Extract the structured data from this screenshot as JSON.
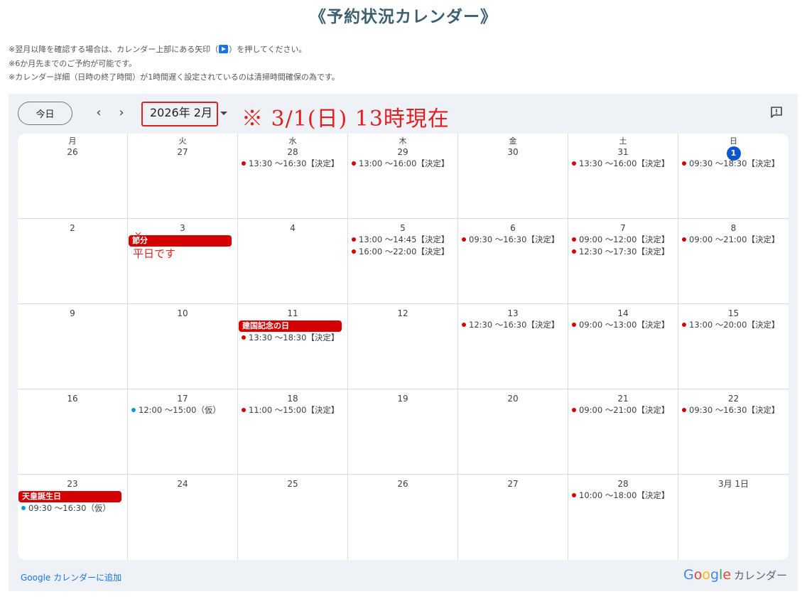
{
  "page_title": "《予約状況カレンダー》",
  "notes": {
    "line1_a": "※翌月以降を確認する場合は、カレンダー上部にある矢印（",
    "line1_b": "）を押してください。",
    "line2": "※6か月先までのご予約が可能です。",
    "line3": "※カレンダー詳細（日時の終了時間）が1時間遅く設定されているのは清掃時間確保の為です。"
  },
  "toolbar": {
    "today_label": "今日",
    "prev_glyph": "‹",
    "next_glyph": "›",
    "month_label": "2026年 2月",
    "handwritten_note": "※ 3/1(日) 13時現在"
  },
  "colors": {
    "confirmed_dot": "#d50000",
    "tentative_dot": "#039be5",
    "holiday_bg": "#d50000",
    "today_circle": "#0b57d0"
  },
  "weekdays": [
    "月",
    "火",
    "水",
    "木",
    "金",
    "土",
    "日"
  ],
  "weeks": [
    [
      {
        "day": "26",
        "events": []
      },
      {
        "day": "27",
        "events": []
      },
      {
        "day": "28",
        "events": [
          {
            "text": "13:30 〜16:30【決定】",
            "status": "confirmed"
          }
        ]
      },
      {
        "day": "29",
        "events": [
          {
            "text": "13:00 〜16:00【決定】",
            "status": "confirmed"
          }
        ]
      },
      {
        "day": "30",
        "events": []
      },
      {
        "day": "31",
        "events": [
          {
            "text": "13:30 〜16:00【決定】",
            "status": "confirmed"
          }
        ]
      },
      {
        "day": "1",
        "today": true,
        "events": [
          {
            "text": "09:30 〜18:30【決定】",
            "status": "confirmed"
          }
        ]
      }
    ],
    [
      {
        "day": "2",
        "events": []
      },
      {
        "day": "3",
        "holiday": "節分",
        "handnote": "平日です",
        "events": []
      },
      {
        "day": "4",
        "events": []
      },
      {
        "day": "5",
        "events": [
          {
            "text": "13:00 〜14:45【決定】",
            "status": "confirmed"
          },
          {
            "text": "16:00 〜22:00【決定】",
            "status": "confirmed"
          }
        ]
      },
      {
        "day": "6",
        "events": [
          {
            "text": "09:30 〜16:30【決定】",
            "status": "confirmed"
          }
        ]
      },
      {
        "day": "7",
        "events": [
          {
            "text": "09:00 〜12:00【決定】",
            "status": "confirmed"
          },
          {
            "text": "12:30 〜17:30【決定】",
            "status": "confirmed"
          }
        ]
      },
      {
        "day": "8",
        "events": [
          {
            "text": "09:00 〜21:00【決定】",
            "status": "confirmed"
          }
        ]
      }
    ],
    [
      {
        "day": "9",
        "events": []
      },
      {
        "day": "10",
        "events": []
      },
      {
        "day": "11",
        "holiday": "建国記念の日",
        "events": [
          {
            "text": "13:30 〜18:30【決定】",
            "status": "confirmed"
          }
        ]
      },
      {
        "day": "12",
        "events": []
      },
      {
        "day": "13",
        "events": [
          {
            "text": "12:30 〜16:30【決定】",
            "status": "confirmed"
          }
        ]
      },
      {
        "day": "14",
        "events": [
          {
            "text": "09:00 〜13:00【決定】",
            "status": "confirmed"
          }
        ]
      },
      {
        "day": "15",
        "events": [
          {
            "text": "13:00 〜20:00【決定】",
            "status": "confirmed"
          }
        ]
      }
    ],
    [
      {
        "day": "16",
        "events": []
      },
      {
        "day": "17",
        "events": [
          {
            "text": "12:00 〜15:00（仮）",
            "status": "tentative"
          }
        ]
      },
      {
        "day": "18",
        "events": [
          {
            "text": "11:00 〜15:00【決定】",
            "status": "confirmed"
          }
        ]
      },
      {
        "day": "19",
        "events": []
      },
      {
        "day": "20",
        "events": []
      },
      {
        "day": "21",
        "events": [
          {
            "text": "09:00 〜21:00【決定】",
            "status": "confirmed"
          }
        ]
      },
      {
        "day": "22",
        "events": [
          {
            "text": "09:30 〜16:30【決定】",
            "status": "confirmed"
          }
        ]
      }
    ],
    [
      {
        "day": "23",
        "holiday": "天皇誕生日",
        "events": [
          {
            "text": "09:30 〜16:30（仮）",
            "status": "tentative"
          }
        ]
      },
      {
        "day": "24",
        "events": []
      },
      {
        "day": "25",
        "events": []
      },
      {
        "day": "26",
        "events": []
      },
      {
        "day": "27",
        "events": []
      },
      {
        "day": "28",
        "events": [
          {
            "text": "10:00 〜18:00【決定】",
            "status": "confirmed"
          }
        ]
      },
      {
        "day": "3月 1日",
        "events": []
      }
    ]
  ],
  "footer": {
    "add_link": "Google カレンダーに追加",
    "brand_letters": [
      {
        "ch": "G",
        "color": "#4285f4"
      },
      {
        "ch": "o",
        "color": "#ea4335"
      },
      {
        "ch": "o",
        "color": "#fbbc05"
      },
      {
        "ch": "g",
        "color": "#4285f4"
      },
      {
        "ch": "l",
        "color": "#34a853"
      },
      {
        "ch": "e",
        "color": "#ea4335"
      }
    ],
    "brand_suffix": "カレンダー"
  }
}
